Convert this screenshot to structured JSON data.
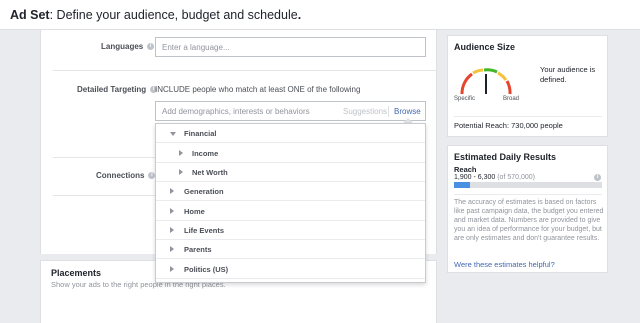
{
  "header": {
    "title_bold": "Ad Set",
    "title_rest": ": Define your audience, budget and schedule",
    "title_end": "."
  },
  "form": {
    "languages_label": "Languages",
    "languages_placeholder": "Enter a language...",
    "detailed_targeting_label": "Detailed Targeting",
    "include_text": "INCLUDE people who match at least ONE of the following",
    "targeting_placeholder": "Add demographics, interests or behaviors",
    "suggestions_label": "Suggestions",
    "browse_label": "Browse",
    "connections_label": "Connections"
  },
  "dropdown": {
    "items": [
      {
        "label": "Financial",
        "expanded": true,
        "level": 0
      },
      {
        "label": "Income",
        "expanded": false,
        "level": 1
      },
      {
        "label": "Net Worth",
        "expanded": false,
        "level": 1
      },
      {
        "label": "Generation",
        "expanded": false,
        "level": 0
      },
      {
        "label": "Home",
        "expanded": false,
        "level": 0
      },
      {
        "label": "Life Events",
        "expanded": false,
        "level": 0
      },
      {
        "label": "Parents",
        "expanded": false,
        "level": 0
      },
      {
        "label": "Politics (US)",
        "expanded": false,
        "level": 0
      }
    ]
  },
  "placements": {
    "title": "Placements",
    "subtitle": "Show your ads to the right people in the right places."
  },
  "audience_size": {
    "title": "Audience Size",
    "description": "Your audience is defined.",
    "specific_label": "Specific",
    "broad_label": "Broad",
    "potential_reach": "Potential Reach: 730,000 people",
    "needle_position": 0.5
  },
  "estimated_results": {
    "title": "Estimated Daily Results",
    "reach_label": "Reach",
    "range": "1,900 - 6,300",
    "of_total": "(of 570,000)",
    "bar_fill_fraction": 0.11,
    "description": "The accuracy of estimates is based on factors like past campaign data, the budget you entered and market data. Numbers are provided to give you an idea of performance for your budget, but are only estimates and don't guarantee results.",
    "helpful_link": "Were these estimates helpful?"
  },
  "colors": {
    "link_blue": "#4267b2",
    "bar_blue": "#4a90e2",
    "gauge_red": "#e5452d",
    "gauge_yellow": "#f5c33b",
    "gauge_green": "#42b72a"
  }
}
